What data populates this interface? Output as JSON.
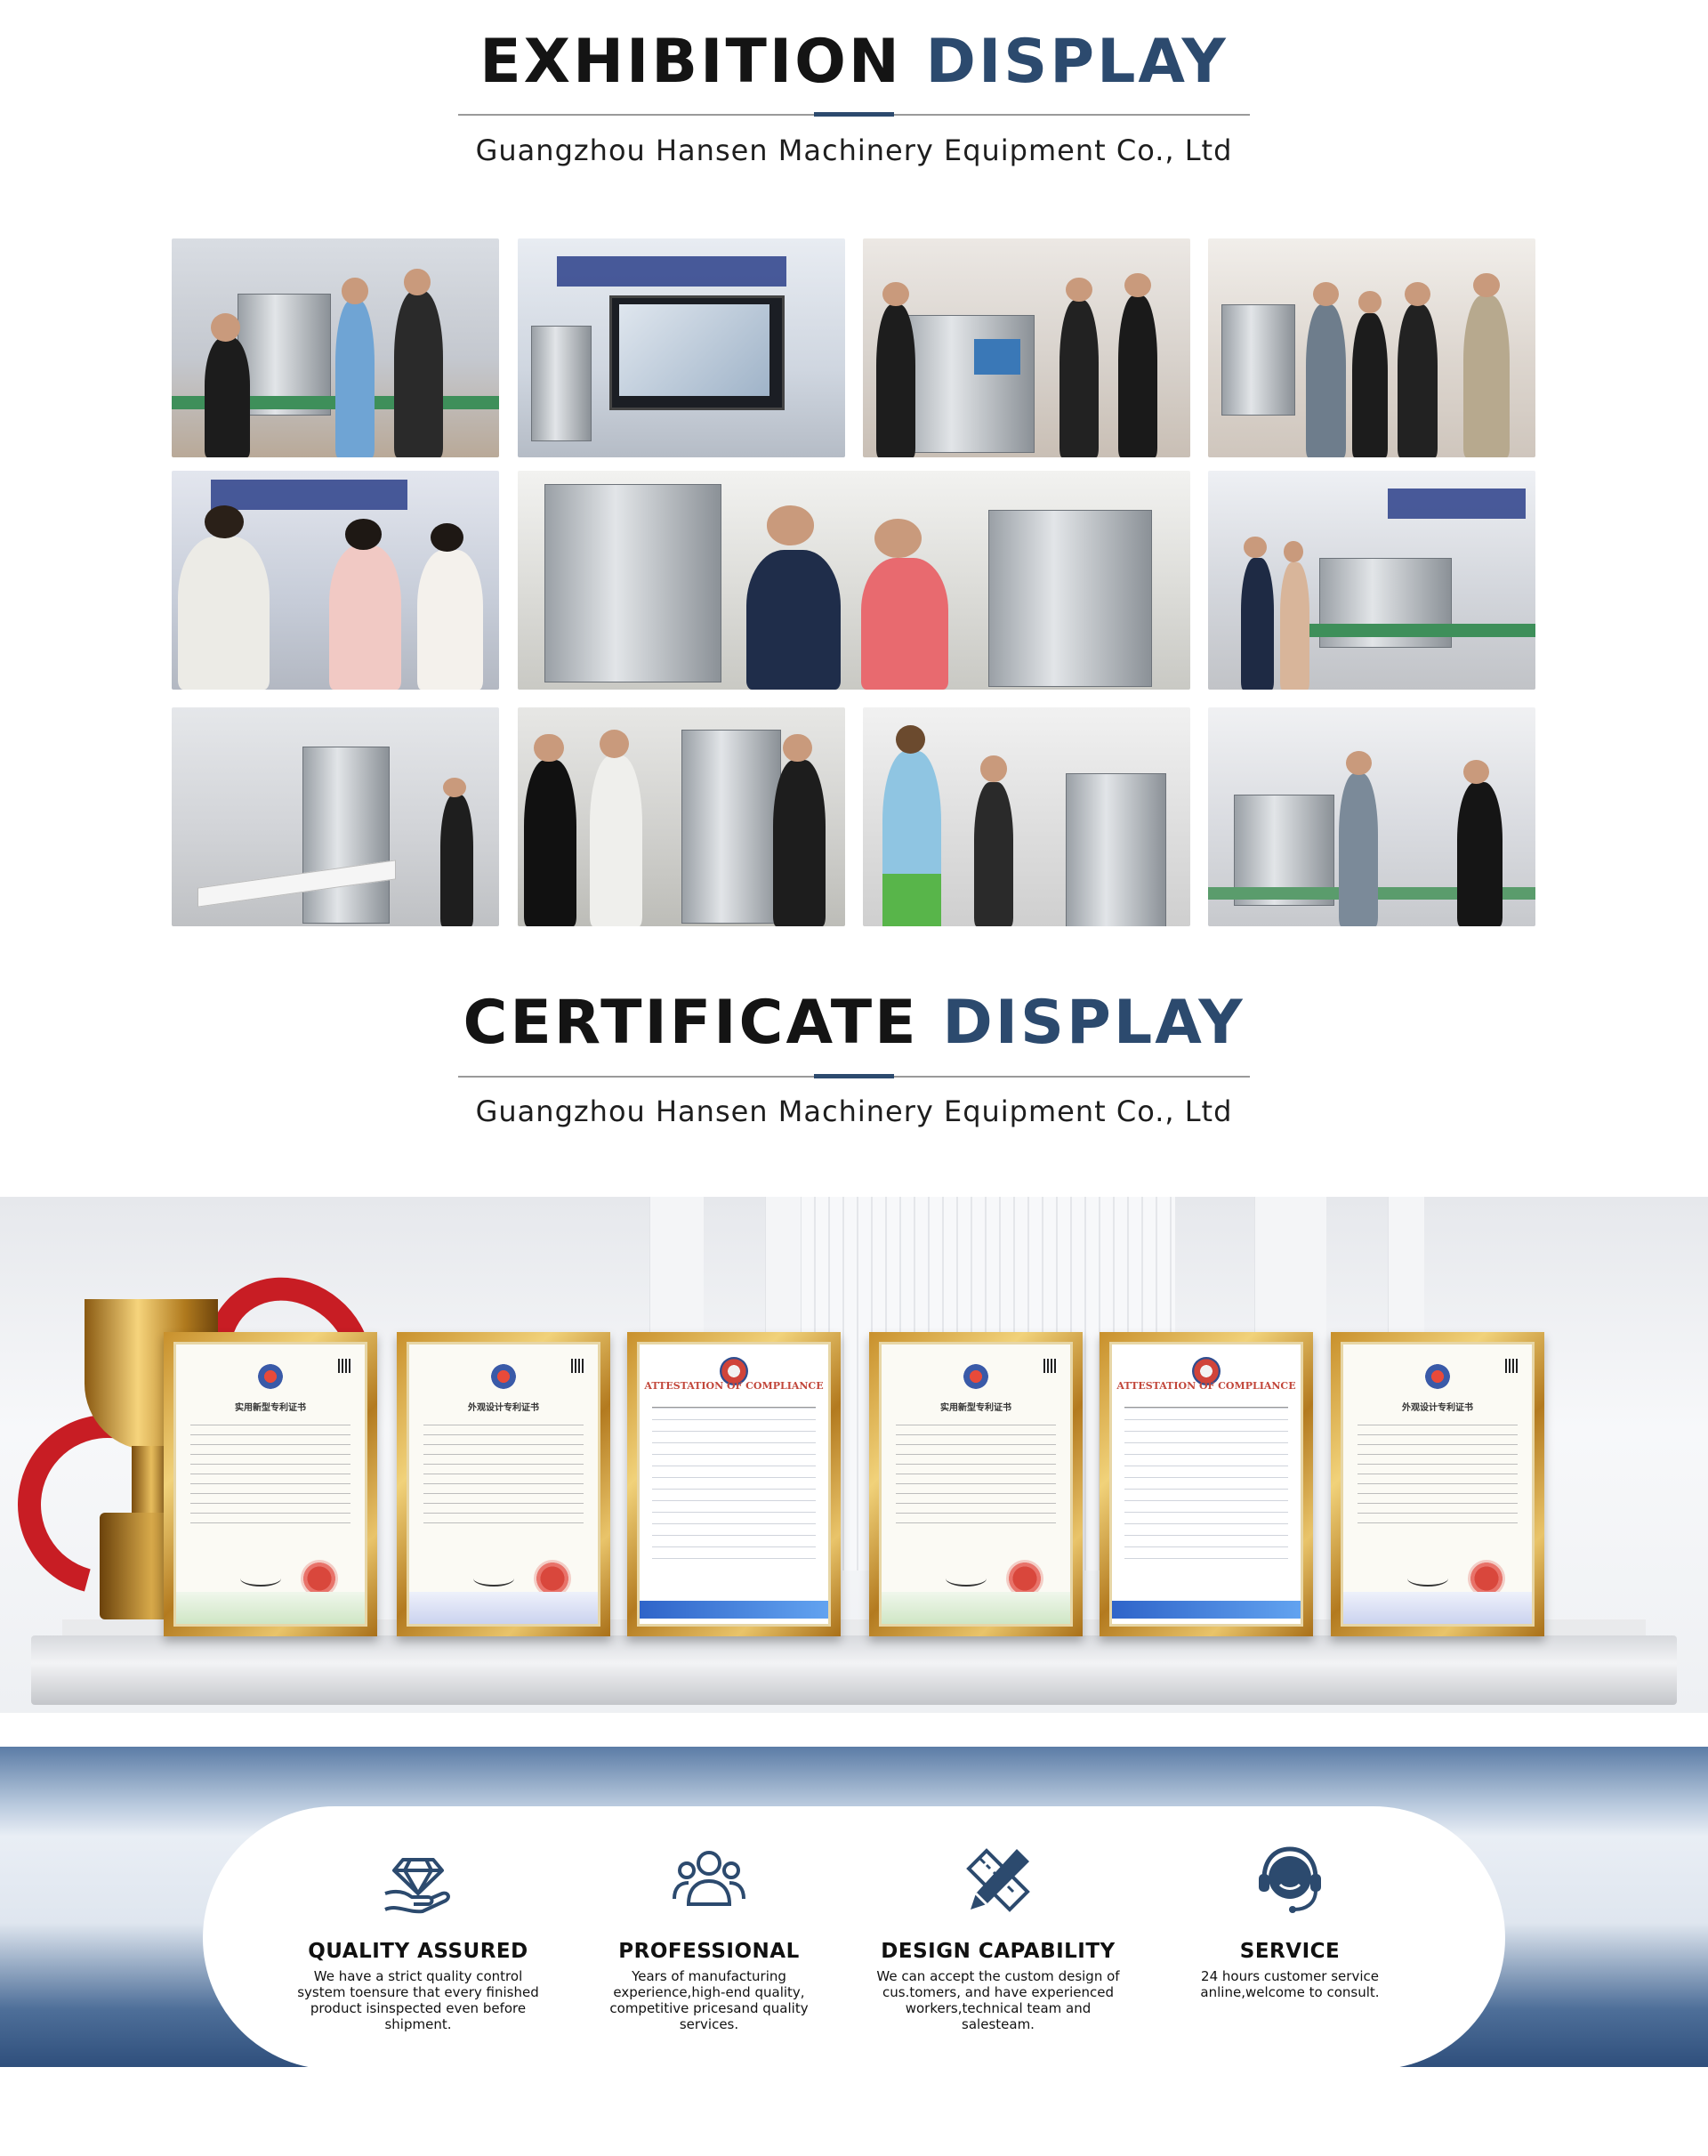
{
  "exhibition": {
    "title_dark": "EXHIBITION",
    "title_accent": "DISPLAY",
    "subtitle": "Guangzhou Hansen Machinery Equipment Co., Ltd"
  },
  "certificates": {
    "title_dark": "CERTIFICATE",
    "title_accent": "DISPLAY",
    "subtitle": "Guangzhou Hansen Machinery Equipment Co., Ltd",
    "items": [
      {
        "title": "实用新型专利证书"
      },
      {
        "title": "外观设计专利证书"
      },
      {
        "title": "ATTESTATION OF COMPLIANCE"
      },
      {
        "title": "实用新型专利证书"
      },
      {
        "title": "ATTESTATION OF COMPLIANCE"
      },
      {
        "title": "外观设计专利证书"
      }
    ]
  },
  "services": [
    {
      "icon": "diamond-hand-icon",
      "title": "QUALITY ASSURED",
      "desc": "We have a strict quality control system toensure that every finished product isinspected even before shipment."
    },
    {
      "icon": "people-group-icon",
      "title": "PROFESSIONAL",
      "desc": "Years of manufacturing experience,high-end quality, competitive pricesand quality services."
    },
    {
      "icon": "pencil-ruler-icon",
      "title": "DESIGN CAPABILITY",
      "desc": "We can accept the custom design of cus.tomers, and have experienced workers,technical team and salesteam."
    },
    {
      "icon": "headset-icon",
      "title": "SERVICE",
      "desc": "24 hours customer service anline,welcome to consult."
    }
  ],
  "colors": {
    "accent": "#2c4a6e",
    "text": "#141414",
    "band": "#2f4f7c"
  }
}
